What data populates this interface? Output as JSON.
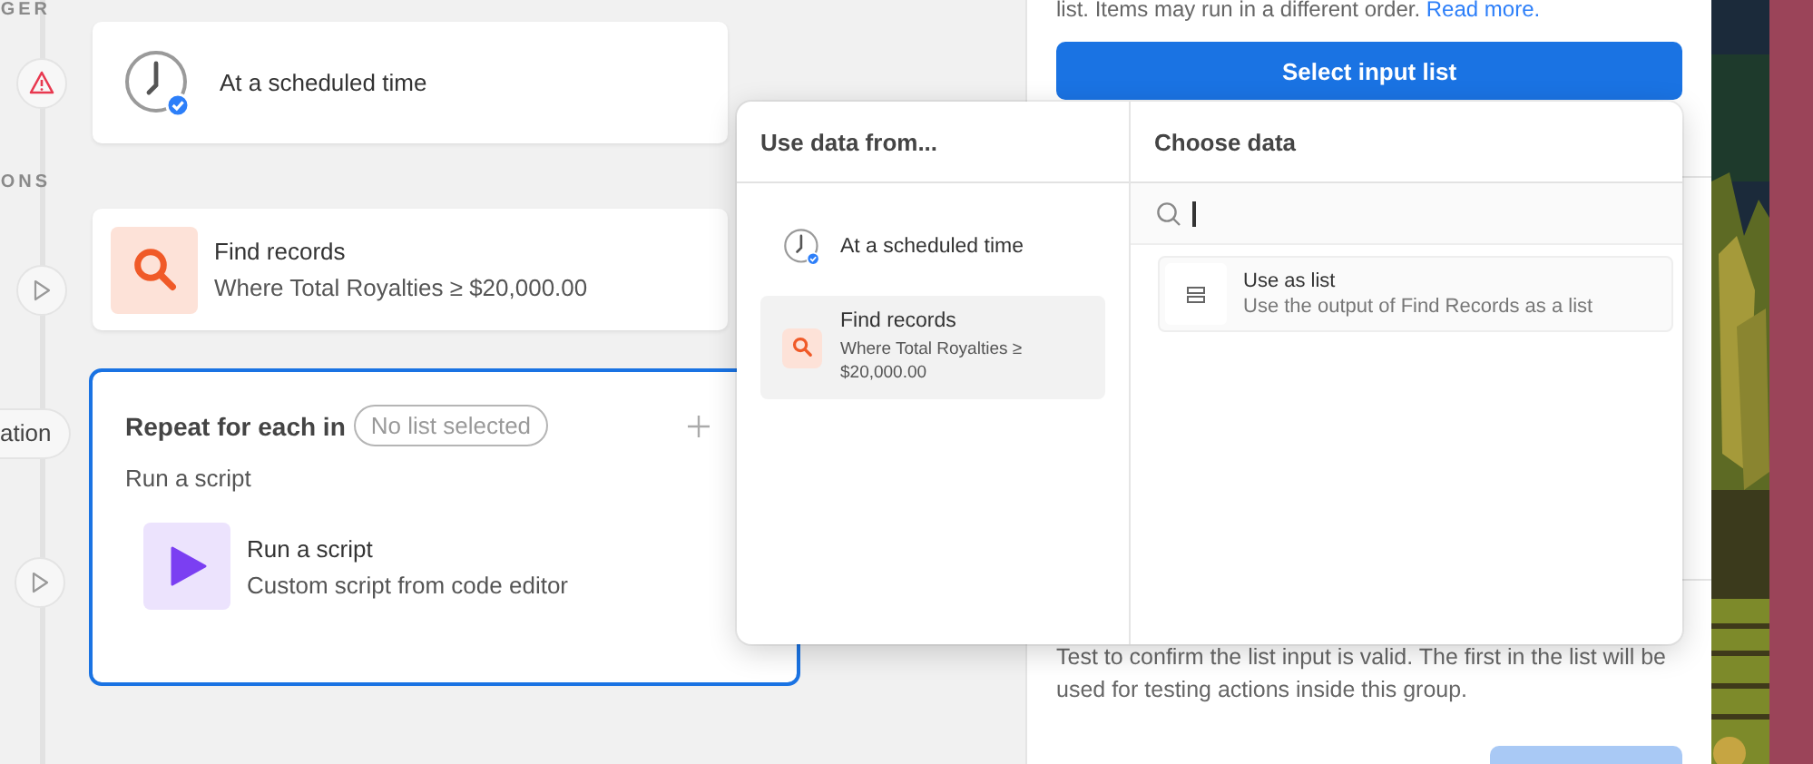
{
  "workflow": {
    "section_labels": [
      "GER",
      "ONS"
    ],
    "steps": [
      {
        "kind": "trigger",
        "warning": true,
        "title": "At a scheduled time",
        "selected": false
      },
      {
        "kind": "action",
        "title": "Find records",
        "subtitle": "Where Total Royalties ≥ $20,000.00",
        "selected": false
      },
      {
        "kind": "repeat",
        "rail_label": "ation",
        "title": "Repeat for each in",
        "list_placeholder": "No list selected",
        "group_label": "Run a script",
        "selected": true,
        "children": [
          {
            "kind": "script",
            "title": "Run a script",
            "subtitle": "Custom script from code editor"
          }
        ]
      }
    ]
  },
  "panel": {
    "description": "list. Items may run in a different order.",
    "link": "Read more.",
    "button": "Select input list",
    "test_note": "Test to confirm the list input is valid. The first in the list will be used for testing actions inside this group."
  },
  "popup": {
    "sources_title": "Use data from...",
    "sources": [
      {
        "kind": "clock",
        "title": "At a scheduled time",
        "selected": false
      },
      {
        "kind": "search",
        "title": "Find records",
        "subtitle": "Where Total Royalties ≥ $20,000.00",
        "selected": true
      }
    ],
    "choose_title": "Choose data",
    "options": [
      {
        "title": "Use as list",
        "subtitle": "Use the output of Find Records as a list"
      }
    ]
  }
}
